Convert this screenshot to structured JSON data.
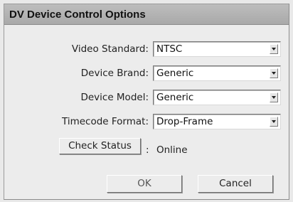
{
  "dialog": {
    "title": "DV Device Control Options"
  },
  "fields": [
    {
      "label": "Video Standard:",
      "value": "NTSC"
    },
    {
      "label": "Device Brand:",
      "value": "Generic"
    },
    {
      "label": "Device Model:",
      "value": "Generic"
    },
    {
      "label": "Timecode Format:",
      "value": "Drop-Frame"
    }
  ],
  "status": {
    "button_label": "Check Status",
    "separator": ":",
    "text": "Online"
  },
  "buttons": {
    "ok_label": "OK",
    "cancel_label": "Cancel"
  },
  "icons": {
    "dropdown": "chevron-down-icon"
  }
}
